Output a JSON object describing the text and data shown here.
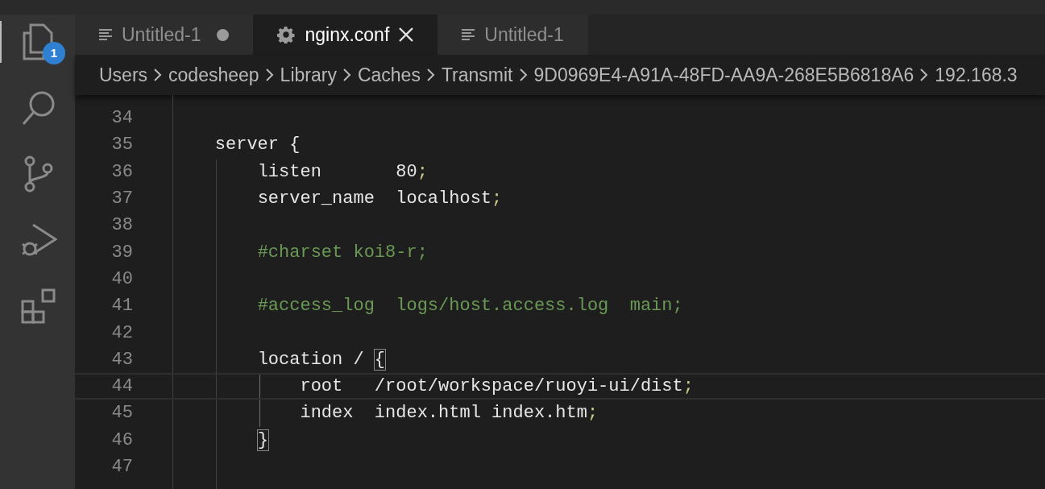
{
  "activity_bar": {
    "items": [
      {
        "kind": "explorer",
        "selected": true,
        "badge": "1"
      },
      {
        "kind": "search",
        "selected": false
      },
      {
        "kind": "source-control",
        "selected": false
      },
      {
        "kind": "run",
        "selected": false
      },
      {
        "kind": "extensions",
        "selected": false
      }
    ]
  },
  "tabs": [
    {
      "label": "Untitled-1",
      "kind": "text",
      "selected": false,
      "dirty": true
    },
    {
      "label": "nginx.conf",
      "kind": "config",
      "selected": true,
      "dirty": false
    },
    {
      "label": "Untitled-1",
      "kind": "text",
      "selected": false,
      "dirty": false
    }
  ],
  "breadcrumb": [
    "Users",
    "codesheep",
    "Library",
    "Caches",
    "Transmit",
    "9D0969E4-A91A-48FD-AA9A-268E5B6818A6",
    "192.168.3"
  ],
  "editor": {
    "lines": [
      {
        "number": "34",
        "current": false
      },
      {
        "number": "35",
        "current": false,
        "segments": [
          {
            "kind": "code",
            "text": "    server {"
          }
        ]
      },
      {
        "number": "36",
        "current": false,
        "segments": [
          {
            "kind": "code",
            "text": "        listen       80"
          },
          {
            "kind": "punct",
            "text": ";"
          }
        ]
      },
      {
        "number": "37",
        "current": false,
        "segments": [
          {
            "kind": "code",
            "text": "        server_name  localhost"
          },
          {
            "kind": "punct",
            "text": ";"
          }
        ]
      },
      {
        "number": "38",
        "current": false
      },
      {
        "number": "39",
        "current": false,
        "segments": [
          {
            "kind": "comment",
            "text": "        #charset koi8-r;"
          }
        ]
      },
      {
        "number": "40",
        "current": false
      },
      {
        "number": "41",
        "current": false,
        "segments": [
          {
            "kind": "comment",
            "text": "        #access_log  logs/host.access.log  main;"
          }
        ]
      },
      {
        "number": "42",
        "current": false
      },
      {
        "number": "43",
        "current": false,
        "segments": [
          {
            "kind": "code",
            "text": "        location / "
          },
          {
            "kind": "bracket",
            "text": "{"
          }
        ]
      },
      {
        "number": "44",
        "current": true,
        "segments": [
          {
            "kind": "code",
            "text": "            root   /root/workspace/ruoyi-ui/dist"
          },
          {
            "kind": "punct",
            "text": ";"
          }
        ]
      },
      {
        "number": "45",
        "current": false,
        "segments": [
          {
            "kind": "code",
            "text": "            index  index.html index.htm"
          },
          {
            "kind": "punct",
            "text": ";"
          }
        ]
      },
      {
        "number": "46",
        "current": false,
        "segments": [
          {
            "kind": "bracket",
            "text": "        }"
          }
        ]
      },
      {
        "number": "47",
        "current": false
      }
    ]
  }
}
